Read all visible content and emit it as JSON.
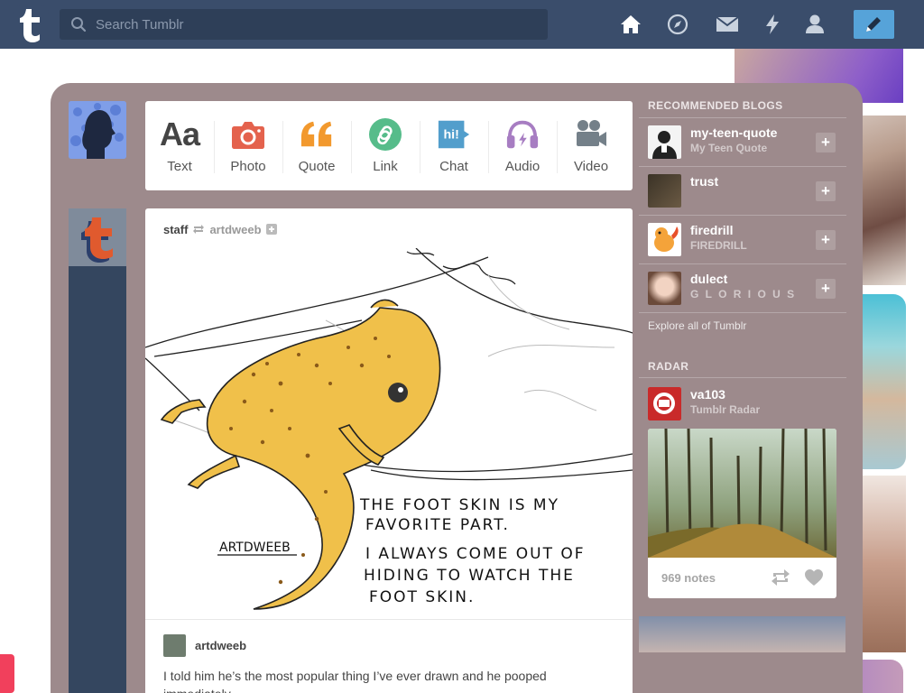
{
  "search": {
    "placeholder": "Search Tumblr"
  },
  "nav": [
    "home-icon",
    "explore-compass-icon",
    "messages-icon",
    "activity-lightning-icon",
    "account-icon",
    "compose-pencil-icon"
  ],
  "post_types": [
    {
      "label": "Text",
      "icon": "text-icon",
      "color": "#444444"
    },
    {
      "label": "Photo",
      "icon": "camera-icon",
      "color": "#e4624d"
    },
    {
      "label": "Quote",
      "icon": "quote-icon",
      "color": "#f2992e"
    },
    {
      "label": "Link",
      "icon": "link-icon",
      "color": "#56bc8a"
    },
    {
      "label": "Chat",
      "icon": "chat-icon",
      "color": "#529ecc"
    },
    {
      "label": "Audio",
      "icon": "headphones-icon",
      "color": "#a77dc2"
    },
    {
      "label": "Video",
      "icon": "video-camera-icon",
      "color": "#748089"
    }
  ],
  "post": {
    "reblogger": "staff",
    "source": "artdweeb",
    "art_lettering": {
      "line1": "THE FOOT SKIN IS MY",
      "line2": "FAVORITE PART.",
      "line3": "I ALWAYS COME OUT OF",
      "line4": "HIDING TO WATCH THE",
      "line5": "FOOT SKIN.",
      "signature": "ARTDWEEB"
    },
    "author": "artdweeb",
    "body": "I told him he’s the most popular thing I’ve ever drawn and he pooped immediately."
  },
  "sidebar": {
    "recommended_heading": "RECOMMENDED BLOGS",
    "blogs": [
      {
        "name": "my-teen-quote",
        "title": "My Teen Quote"
      },
      {
        "name": "trust",
        "title": ""
      },
      {
        "name": "firedrill",
        "title": "FIREDRILL"
      },
      {
        "name": "dulect",
        "title": "G L O R I O U S"
      }
    ],
    "explore_label": "Explore all of Tumblr",
    "radar_heading": "RADAR",
    "radar": {
      "name": "va103",
      "title": "Tumblr Radar",
      "notes": "969 notes"
    }
  },
  "colors": {
    "topbar": "#3a4d6b",
    "dashboard": "#9d8a8c",
    "compose": "#56a3d9",
    "post_rail": "#34465f"
  }
}
